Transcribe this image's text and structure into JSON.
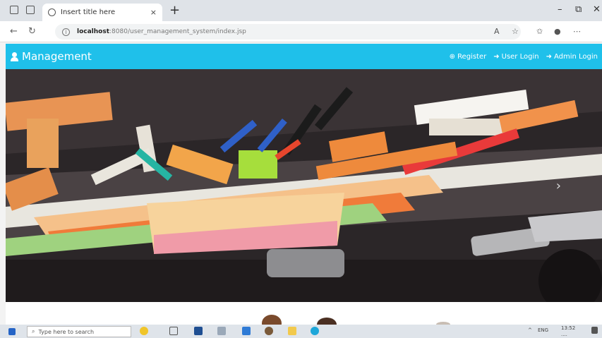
{
  "browser": {
    "tab_title": "Insert title here",
    "tab_close": "×",
    "new_tab": "+",
    "url_host": "localhost",
    "url_rest": ":8080/user_management_system/index.jsp",
    "minimize": "–",
    "maximize": "⧉",
    "close": "✕"
  },
  "app": {
    "brand": "Management",
    "links": [
      {
        "icon": "register-icon",
        "label": "Register"
      },
      {
        "icon": "login-icon",
        "label": "User Login"
      },
      {
        "icon": "login-icon",
        "label": "Admin Login"
      }
    ],
    "accent": "#1fc0ea"
  },
  "carousel": {
    "next": "›"
  },
  "taskbar": {
    "search_placeholder": "Type here to search",
    "lang": "ENG",
    "time": "13:52",
    "date": "...."
  }
}
